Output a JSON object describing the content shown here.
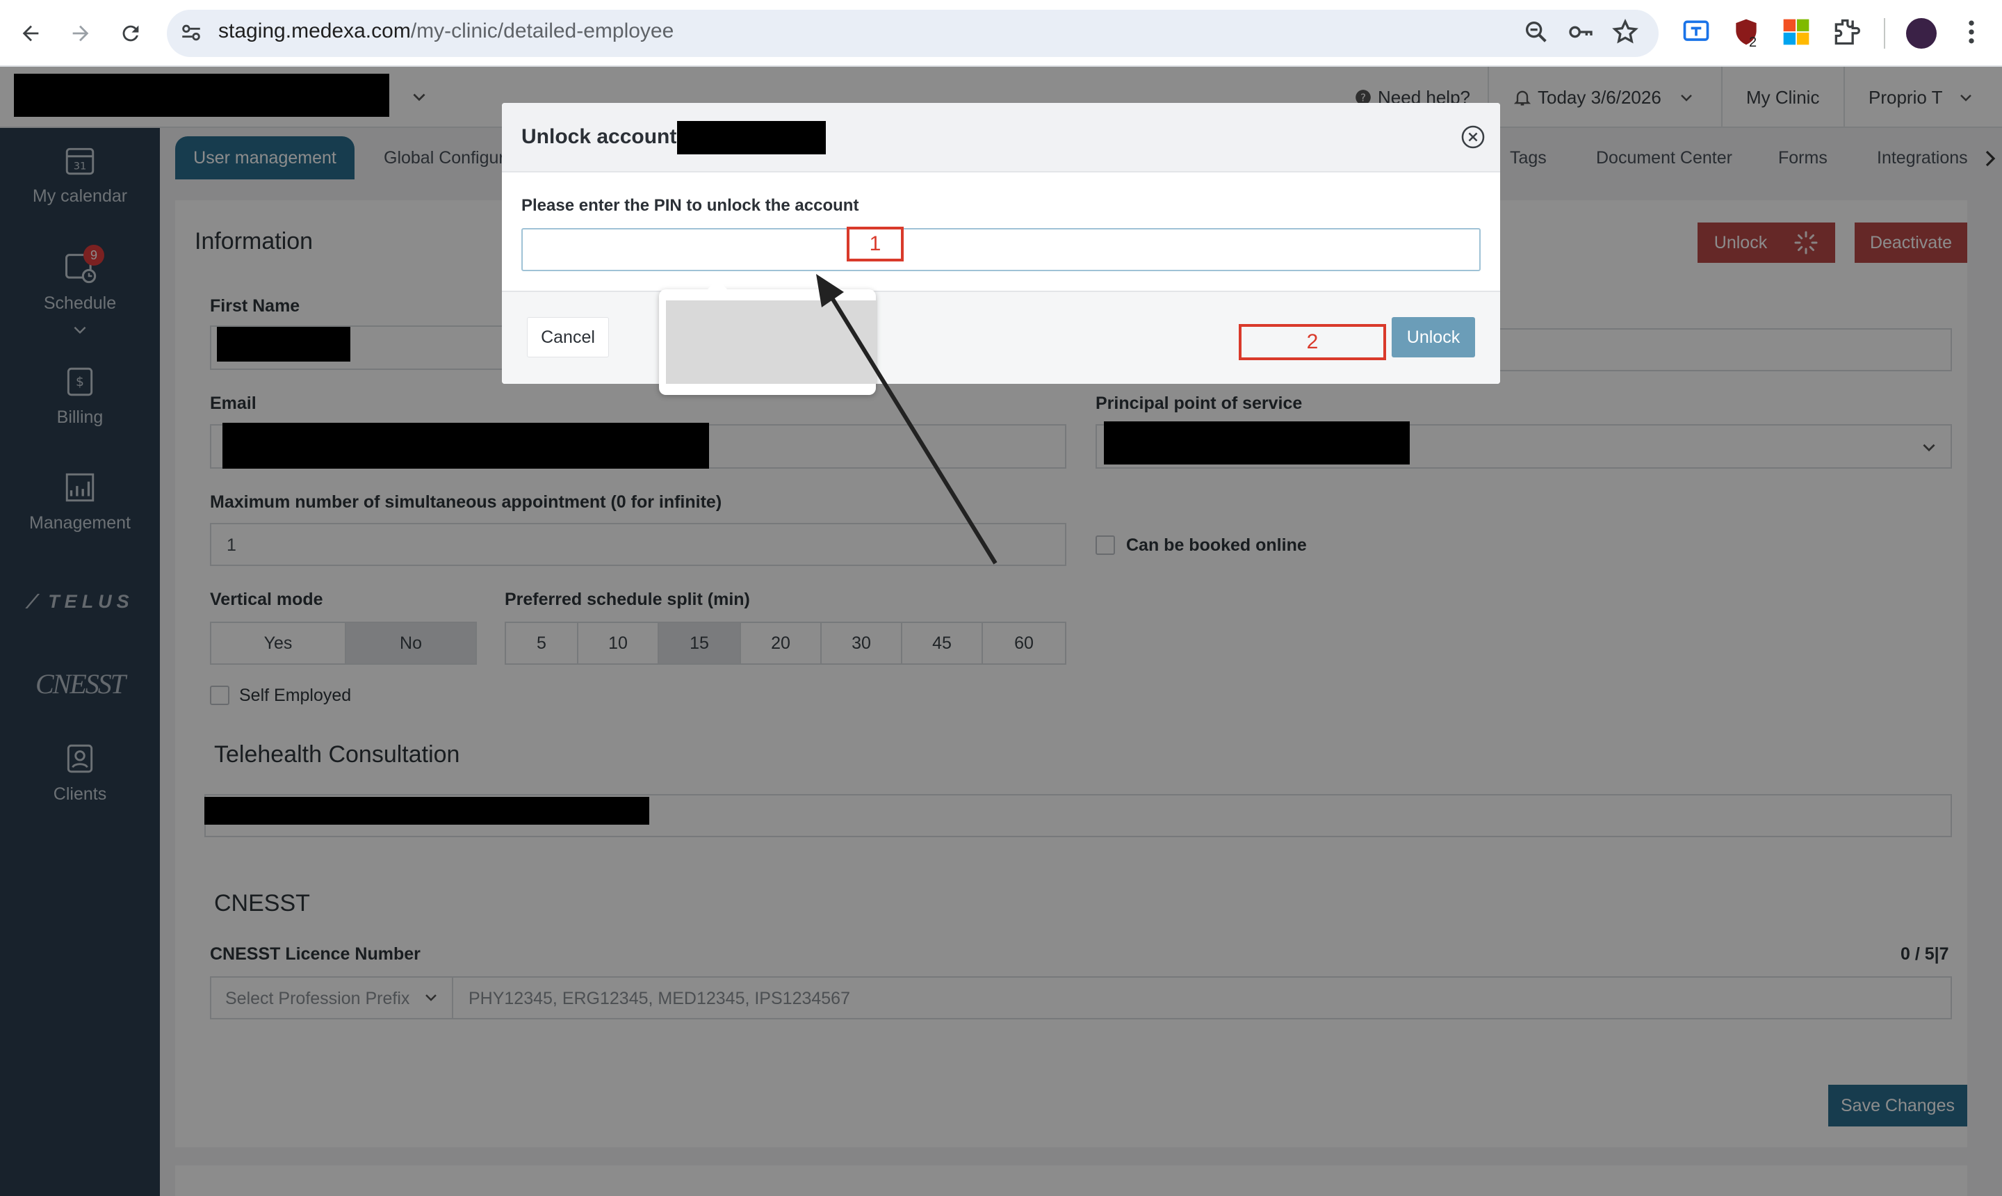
{
  "browser": {
    "url_host": "staging.medexa.com",
    "url_path": "/my-clinic/detailed-employee",
    "ext_badge": "2"
  },
  "topbar": {
    "help": "Need help?",
    "today": "Today 3/6/2026",
    "clinic": "My Clinic",
    "user": "Proprio T"
  },
  "sidebar": {
    "calendar_day": "31",
    "schedule_badge": "9",
    "items": [
      {
        "label": "My calendar"
      },
      {
        "label": "Schedule"
      },
      {
        "label": "Billing"
      },
      {
        "label": "Management"
      },
      {
        "label": "TELUS"
      },
      {
        "label": "CNESST"
      },
      {
        "label": "Clients"
      }
    ]
  },
  "tabs": [
    {
      "label": "User management"
    },
    {
      "label": "Global Configur"
    },
    {
      "label": "Tags"
    },
    {
      "label": "Document Center"
    },
    {
      "label": "Forms"
    },
    {
      "label": "Integrations"
    }
  ],
  "info": {
    "title": "Information",
    "unlock_label": "Unlock",
    "deactivate_label": "Deactivate",
    "first_name_label": "First Name",
    "email_label": "Email",
    "pos_label": "Principal point of service",
    "max_appt_label": "Maximum number of simultaneous appointment (0 for infinite)",
    "max_appt_value": "1",
    "booked_online_label": "Can be booked online",
    "vertical_mode_label": "Vertical mode",
    "vertical_yes": "Yes",
    "vertical_no": "No",
    "split_label": "Preferred schedule split (min)",
    "splits": [
      "5",
      "10",
      "15",
      "20",
      "30",
      "45",
      "60"
    ],
    "split_selected": "15",
    "self_employed_label": "Self Employed"
  },
  "telehealth": {
    "title": "Telehealth Consultation"
  },
  "cnesst": {
    "title": "CNESST",
    "licence_label": "CNESST Licence Number",
    "counter": "0 / 5|7",
    "prefix_placeholder": "Select Profession Prefix",
    "licence_placeholder": "PHY12345, ERG12345, MED12345, IPS1234567"
  },
  "save_label": "Save Changes",
  "modal": {
    "title": "Unlock account:",
    "pin_label": "Please enter the PIN to unlock the account",
    "pin_value": "",
    "cancel_label": "Cancel",
    "unlock_label": "Unlock"
  },
  "annotations": {
    "box1": "1",
    "box2": "2"
  },
  "colors": {
    "sidebar": "#2c3e50",
    "tab_active": "#2b6d8f",
    "deactivate": "#b94a48",
    "save": "#2b6d8f",
    "annotation": "#d93a2b"
  }
}
